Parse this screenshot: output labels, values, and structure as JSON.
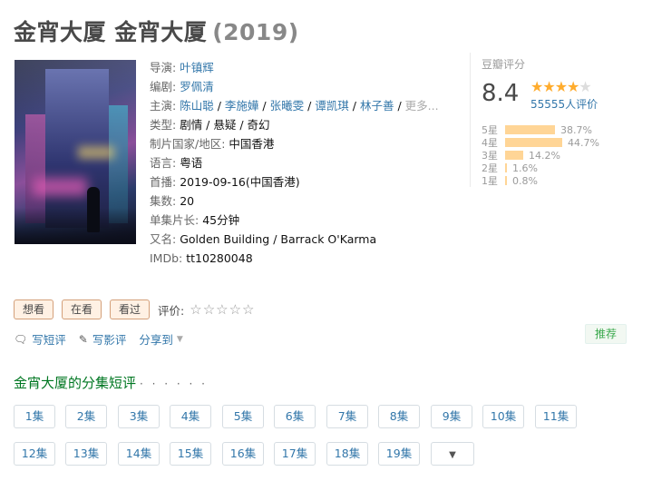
{
  "header": {
    "title": "金宵大厦 金宵大厦",
    "year": "(2019)"
  },
  "info": {
    "director_label": "导演:",
    "director": "叶镇辉",
    "writer_label": "编剧:",
    "writer": "罗佩清",
    "cast_label": "主演:",
    "cast": [
      "陈山聪",
      "李施嬅",
      "张曦雯",
      "谭凯琪",
      "林子善"
    ],
    "cast_more": "更多...",
    "genre_label": "类型:",
    "genre": "剧情 / 悬疑 / 奇幻",
    "country_label": "制片国家/地区:",
    "country": "中国香港",
    "language_label": "语言:",
    "language": "粤语",
    "premiere_label": "首播:",
    "premiere": "2019-09-16(中国香港)",
    "episodes_label": "集数:",
    "episodes": "20",
    "runtime_label": "单集片长:",
    "runtime": "45分钟",
    "aka_label": "又名:",
    "aka": "Golden Building / Barrack O'Karma",
    "imdb_label": "IMDb:",
    "imdb": "tt10280048"
  },
  "rating": {
    "label": "豆瓣评分",
    "score": "8.4",
    "stars": 4,
    "people": "55555人评价",
    "breakdown": [
      {
        "label": "5星",
        "percent": "38.7%",
        "value": 38.7
      },
      {
        "label": "4星",
        "percent": "44.7%",
        "value": 44.7
      },
      {
        "label": "3星",
        "percent": "14.2%",
        "value": 14.2
      },
      {
        "label": "2星",
        "percent": "1.6%",
        "value": 1.6
      },
      {
        "label": "1星",
        "percent": "0.8%",
        "value": 0.8
      }
    ]
  },
  "actions": {
    "want": "想看",
    "watching": "在看",
    "watched": "看过",
    "rate_label": "评价:",
    "rate_stars": "☆☆☆☆☆"
  },
  "share": {
    "short_review": "写短评",
    "review": "写影评",
    "share": "分享到",
    "recommend": "推荐"
  },
  "episodes_section": {
    "title": "金宵大厦的分集短评",
    "dots": "· · · · · ·",
    "items": [
      "1集",
      "2集",
      "3集",
      "4集",
      "5集",
      "6集",
      "7集",
      "8集",
      "9集",
      "10集",
      "11集",
      "12集",
      "13集",
      "14集",
      "15集",
      "16集",
      "17集",
      "18集",
      "19集"
    ]
  },
  "colors": {
    "link": "#3377aa",
    "star": "#ffac2d",
    "section_title": "#007722",
    "bar": "#ffd596"
  }
}
